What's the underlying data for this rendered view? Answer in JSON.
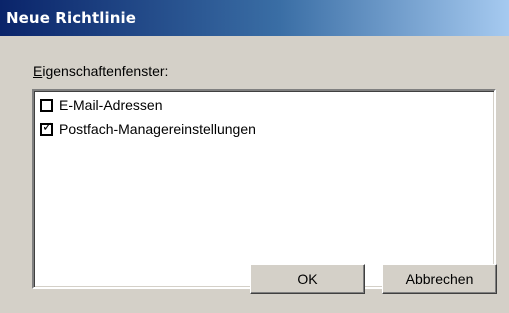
{
  "window": {
    "title": "Neue Richtlinie"
  },
  "properties": {
    "label_accel": "E",
    "label_rest": "igenschaftenfenster:",
    "items": [
      {
        "label": "E-Mail-Adressen",
        "checked": false
      },
      {
        "label": "Postfach-Managereinstellungen",
        "checked": true
      }
    ]
  },
  "buttons": {
    "ok": "OK",
    "cancel": "Abbrechen"
  }
}
